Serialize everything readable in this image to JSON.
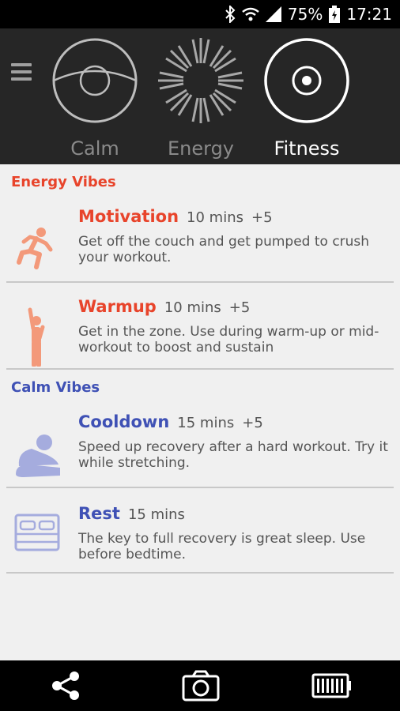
{
  "status_bar": {
    "battery_percent": "75%",
    "time": "17:21",
    "icons": [
      "bluetooth-icon",
      "wifi-icon",
      "signal-icon",
      "battery-icon"
    ]
  },
  "modes": [
    {
      "label": "Calm",
      "active": false
    },
    {
      "label": "Energy",
      "active": false
    },
    {
      "label": "Fitness",
      "active": true
    }
  ],
  "energy_section": {
    "title": "Energy Vibes",
    "color": "#e8442b",
    "items": [
      {
        "title": "Motivation",
        "duration": "10 mins",
        "bonus": "+5",
        "description": "Get off the couch and get pumped to crush your workout.",
        "icon": "running-person-icon"
      },
      {
        "title": "Warmup",
        "duration": "10 mins",
        "bonus": "+5",
        "description": "Get in the zone.  Use during warm-up or mid-workout to boost and sustain",
        "icon": "stretching-standing-person-icon"
      }
    ]
  },
  "calm_section": {
    "title": "Calm Vibes",
    "color": "#3f51b5",
    "items": [
      {
        "title": "Cooldown",
        "duration": "15 mins",
        "bonus": "+5",
        "description": "Speed up recovery after a hard workout. Try it while stretching.",
        "icon": "seated-stretch-icon"
      },
      {
        "title": "Rest",
        "duration": "15 mins",
        "bonus": "",
        "description": "The key to full recovery is great sleep. Use before bedtime.",
        "icon": "bed-icon"
      }
    ]
  },
  "bottom_bar": {
    "icons": [
      "share-icon",
      "camera-icon",
      "battery-level-icon"
    ]
  }
}
